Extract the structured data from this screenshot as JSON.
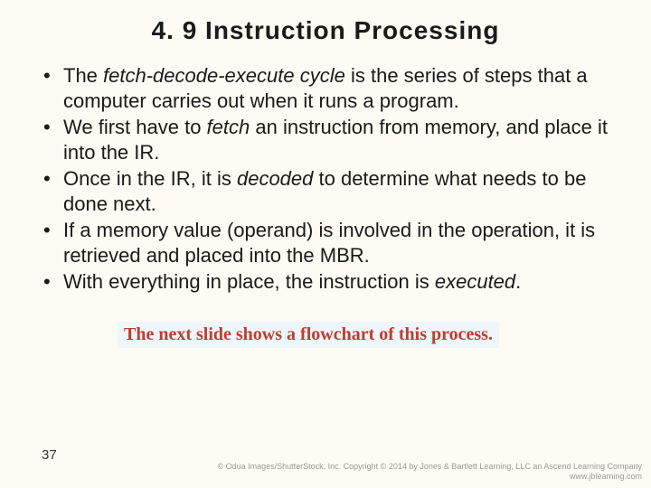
{
  "slide": {
    "title": "4. 9 Instruction Processing",
    "bullets": [
      {
        "pre": "The ",
        "em": "fetch-decode-execute cycle",
        "post": " is the series of steps that a computer carries out when it runs a program."
      },
      {
        "pre": "We first have to ",
        "em": "fetch",
        "post": " an instruction from memory, and place it into the IR."
      },
      {
        "pre": "Once in the IR, it is ",
        "em": "decoded",
        "post": " to determine what needs to be done next."
      },
      {
        "pre": "If a memory value (operand) is involved in the operation, it is retrieved and placed into the MBR.",
        "em": "",
        "post": ""
      },
      {
        "pre": "With everything in place, the instruction is ",
        "em": "executed",
        "post": "."
      }
    ],
    "note": "The next slide shows a flowchart of this process.",
    "page_number": "37",
    "copyright_line1": "© Odua Images/ShutterStock, Inc. Copyright © 2014 by Jones & Bartlett Learning, LLC an Ascend Learning Company",
    "copyright_line2": "www.jblearning.com"
  }
}
